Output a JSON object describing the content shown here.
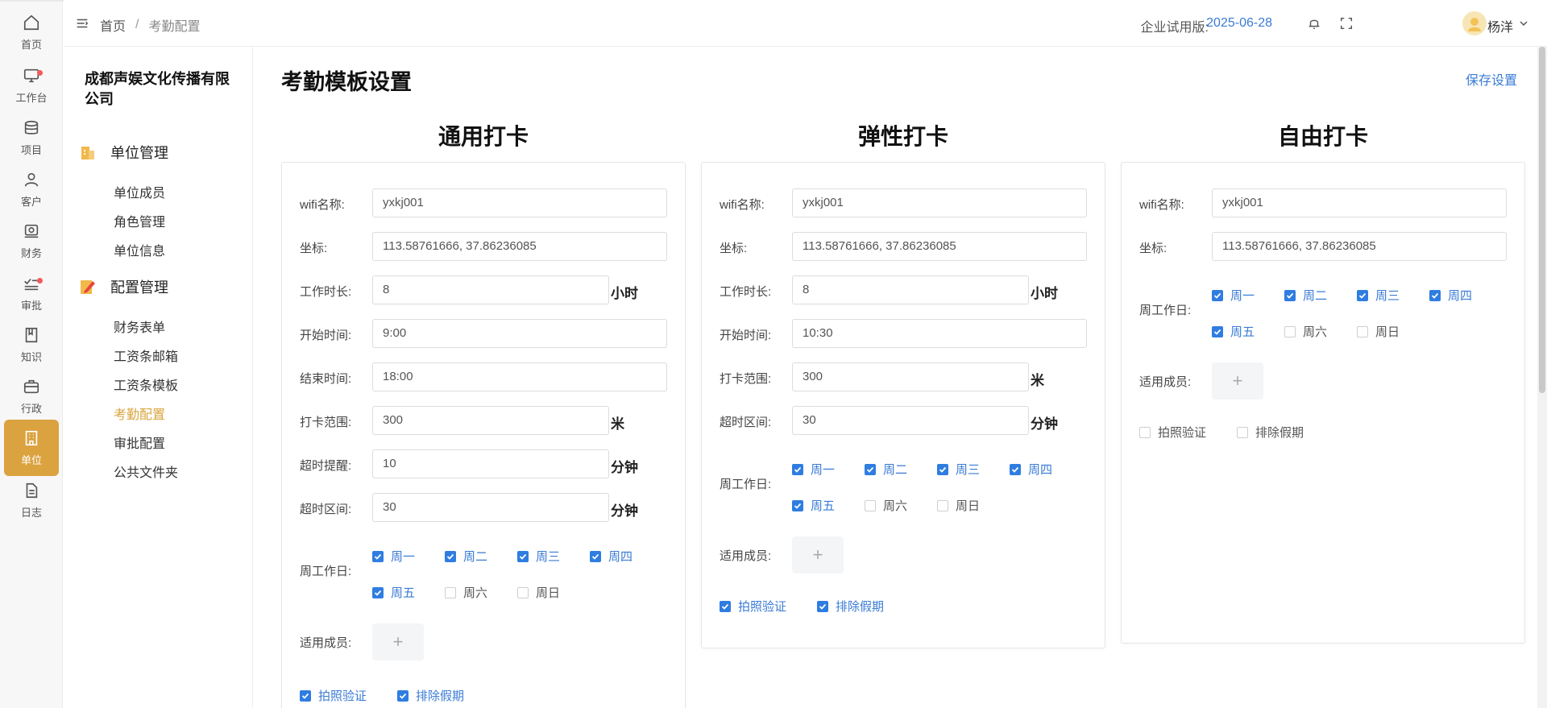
{
  "rail": [
    {
      "name": "home",
      "label": "首页",
      "icon": "home-icon"
    },
    {
      "name": "workbench",
      "label": "工作台",
      "icon": "monitor-icon",
      "dot": true
    },
    {
      "name": "project",
      "label": "项目",
      "icon": "database-icon"
    },
    {
      "name": "customer",
      "label": "客户",
      "icon": "user-icon"
    },
    {
      "name": "finance",
      "label": "财务",
      "icon": "finance-icon"
    },
    {
      "name": "approval",
      "label": "审批",
      "icon": "approval-icon",
      "dot": true
    },
    {
      "name": "knowledge",
      "label": "知识",
      "icon": "book-icon"
    },
    {
      "name": "admin",
      "label": "行政",
      "icon": "briefcase-icon"
    },
    {
      "name": "unit",
      "label": "单位",
      "icon": "building-icon",
      "active": true
    },
    {
      "name": "log",
      "label": "日志",
      "icon": "document-icon"
    }
  ],
  "menu": {
    "company": "成都声娱文化传播有限公司",
    "group1": "单位管理",
    "group1_items": [
      "单位成员",
      "角色管理",
      "单位信息"
    ],
    "group2": "配置管理",
    "group2_items": [
      "财务表单",
      "工资条邮箱",
      "工资条模板",
      "考勤配置",
      "审批配置",
      "公共文件夹"
    ],
    "active_item": "考勤配置"
  },
  "header": {
    "breadcrumb_home": "首页",
    "breadcrumb_sep": "/",
    "breadcrumb_current": "考勤配置",
    "trial_label": "企业试用版:",
    "trial_date": "2025-06-28",
    "username": "杨洋"
  },
  "page": {
    "title": "考勤模板设置",
    "save_label": "保存设置"
  },
  "labels": {
    "wifi": "wifi名称:",
    "coord": "坐标:",
    "duration": "工作时长:",
    "start": "开始时间:",
    "end": "结束时间:",
    "range": "打卡范围:",
    "overtime_remind": "超时提醒:",
    "overtime_range": "超时区间:",
    "weekdays": "周工作日:",
    "members": "适用成员:",
    "unit_hour": "小时",
    "unit_meter": "米",
    "unit_minute": "分钟",
    "photo": "拍照验证",
    "exclude_holiday": "排除假期",
    "days": [
      "周一",
      "周二",
      "周三",
      "周四",
      "周五",
      "周六",
      "周日"
    ]
  },
  "general": {
    "title": "通用打卡",
    "wifi": "yxkj001",
    "coord": "113.58761666, 37.86236085",
    "duration": "8",
    "start": "9:00",
    "end": "18:00",
    "range": "300",
    "overtime_remind": "10",
    "overtime_range": "30",
    "days_checked": [
      true,
      true,
      true,
      true,
      true,
      false,
      false
    ],
    "photo": true,
    "exclude_holiday": true
  },
  "flexible": {
    "title": "弹性打卡",
    "wifi": "yxkj001",
    "coord": "113.58761666, 37.86236085",
    "duration": "8",
    "start": "10:30",
    "range": "300",
    "overtime_range": "30",
    "days_checked": [
      true,
      true,
      true,
      true,
      true,
      false,
      false
    ],
    "photo": true,
    "exclude_holiday": true
  },
  "free": {
    "title": "自由打卡",
    "wifi": "yxkj001",
    "coord": "113.58761666, 37.86236085",
    "days_checked": [
      true,
      true,
      true,
      true,
      true,
      false,
      false
    ],
    "photo": false,
    "exclude_holiday": false
  },
  "colors": {
    "accent": "#dba240",
    "link": "#3a7bd5",
    "checkbox": "#2f7de1"
  }
}
